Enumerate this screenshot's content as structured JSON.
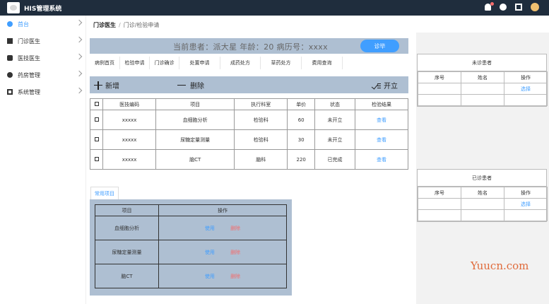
{
  "app": {
    "title": "HIS管理系统"
  },
  "topbar": {
    "icons": [
      "bell-icon",
      "help-icon",
      "edit-icon",
      "avatar"
    ]
  },
  "sidebar": {
    "items": [
      {
        "label": "首台",
        "icon": "dashboard-icon",
        "active": true
      },
      {
        "label": "门诊医生",
        "icon": "outpatient-icon"
      },
      {
        "label": "医技医生",
        "icon": "medtech-icon"
      },
      {
        "label": "药房管理",
        "icon": "pharmacy-icon"
      },
      {
        "label": "系统管理",
        "icon": "system-icon"
      }
    ]
  },
  "breadcrumb": {
    "root": "门诊医生",
    "path": "门诊/检验申请"
  },
  "patient": {
    "text": "当前患者：派大星  年龄：20  病历号：xxxx",
    "finish_label": "诊毕"
  },
  "tabs": [
    "病例首页",
    "检验申请",
    "门诊确诊",
    "处置申请",
    "成药处方",
    "草药处方",
    "费用查询"
  ],
  "actions": {
    "add": "新增",
    "delete": "删除",
    "issue": "开立"
  },
  "items_table": {
    "headers": [
      "☐",
      "医技编码",
      "项目",
      "执行科室",
      "单价",
      "状态",
      "检验结果"
    ],
    "rows": [
      {
        "check": "☐",
        "code": "xxxxx",
        "item": "血细胞分析",
        "dept": "检验科",
        "price": "60",
        "status": "未开立",
        "result": "查看"
      },
      {
        "check": "☐",
        "code": "xxxxx",
        "item": "尿糖定量测量",
        "dept": "检验科",
        "price": "30",
        "status": "未开立",
        "result": "查看"
      },
      {
        "check": "☐",
        "code": "xxxxx",
        "item": "脑CT",
        "dept": "脑科",
        "price": "220",
        "status": "已完成",
        "result": "查看"
      }
    ]
  },
  "common": {
    "tab_label": "常用项目",
    "headers": [
      "项目",
      "操作"
    ],
    "rows": [
      {
        "item": "血细胞分析",
        "use": "使用",
        "del": "删除"
      },
      {
        "item": "尿糖定量测量",
        "use": "使用",
        "del": "删除"
      },
      {
        "item": "脑CT",
        "use": "使用",
        "del": "删除"
      }
    ]
  },
  "pending": {
    "title": "未诊患者",
    "headers": [
      "序号",
      "姓名",
      "操作"
    ],
    "rows": [
      [
        "",
        "",
        "选择"
      ],
      [
        "",
        "",
        ""
      ]
    ]
  },
  "done": {
    "title": "已诊患者",
    "headers": [
      "序号",
      "姓名",
      "操作"
    ],
    "rows": [
      [
        "",
        "",
        "选择"
      ],
      [
        "",
        "",
        ""
      ]
    ]
  },
  "watermark": "Yuucn.com",
  "colors": {
    "accent": "#409eff",
    "danger": "#f56c6c",
    "panel": "#aebfd2",
    "topbar": "#1f2d3d"
  }
}
